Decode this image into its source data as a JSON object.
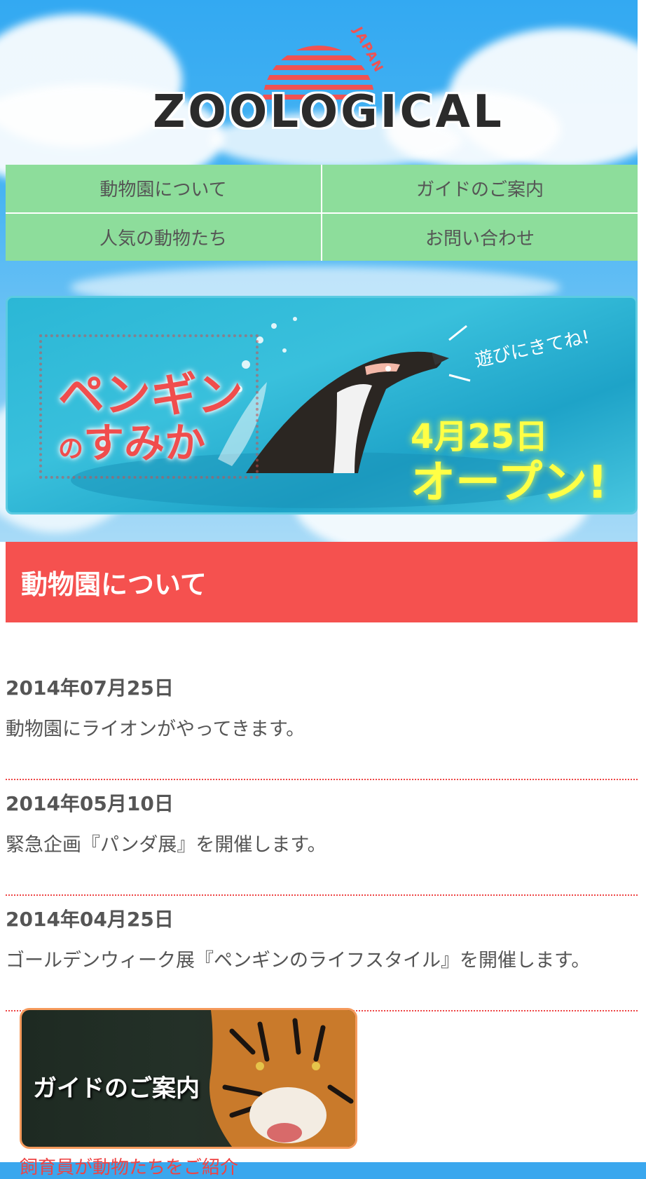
{
  "logo": {
    "text": "ZOOLOGICAL",
    "japan": "JAPAN"
  },
  "nav": {
    "items": [
      {
        "label": "動物園について"
      },
      {
        "label": "ガイドのご案内"
      },
      {
        "label": "人気の動物たち"
      },
      {
        "label": "お問い合わせ"
      }
    ]
  },
  "banner": {
    "title_line1": "ペンギン",
    "title_small": "の",
    "title_line2": "すみか",
    "handwritten": "遊びにきてね!",
    "date": "4月25日",
    "open": "オープン!"
  },
  "section": {
    "title": "動物園について"
  },
  "news": [
    {
      "date": "2014年07月25日",
      "text": "動物園にライオンがやってきます。"
    },
    {
      "date": "2014年05月10日",
      "text": "緊急企画『パンダ展』を開催します。"
    },
    {
      "date": "2014年04月25日",
      "text": "ゴールデンウィーク展『ペンギンのライフスタイル』を開催します。"
    }
  ],
  "guide": {
    "label": "ガイドのご案内",
    "link_partial": "飼育員が動物たちをご紹介"
  },
  "colors": {
    "nav_green": "#8ddd9b",
    "section_red": "#f5514f",
    "accent_yellow": "#ffff45"
  }
}
